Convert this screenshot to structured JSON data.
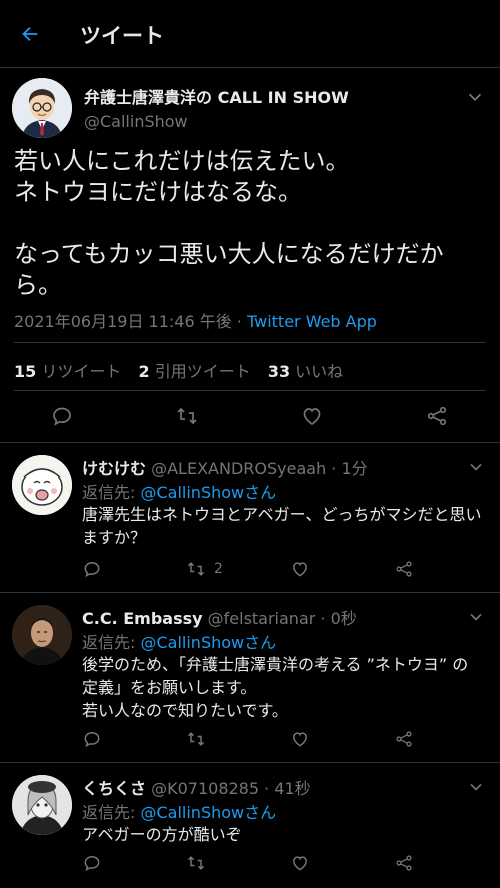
{
  "header": {
    "title": "ツイート"
  },
  "tweet": {
    "name": "弁護士唐澤貴洋の CALL IN SHOW",
    "handle": "@CallinShow",
    "text": "若い人にこれだけは伝えたい。\nネトウヨにだけはなるな。\n\nなってもカッコ悪い大人になるだけだから。",
    "datetime": "2021年06月19日 11:46 午後 · ",
    "app": "Twitter Web App",
    "stats": {
      "retweets_count": "15",
      "retweets_label": "リツイート",
      "quotes_count": "2",
      "quotes_label": "引用ツイート",
      "likes_count": "33",
      "likes_label": "いいね"
    }
  },
  "replies": [
    {
      "name": "けむけむ",
      "handle": "@ALEXANDROSyeaah",
      "time": "· 1分",
      "reply_label": "返信先: ",
      "reply_to": "@CallinShowさん",
      "text": "唐澤先生はネトウヨとアベガー、どっちがマシだと思いますか？",
      "retweet_count": "2"
    },
    {
      "name": "C.C. Embassy",
      "handle": "@felstarianar",
      "time": "· 0秒",
      "reply_label": "返信先: ",
      "reply_to": "@CallinShowさん",
      "text": "後学のため、「弁護士唐澤貴洋の考える ”ネトウヨ” の定義」をお願いします。\n若い人なので知りたいです。",
      "retweet_count": ""
    },
    {
      "name": "くちくさ",
      "handle": "@K07108285",
      "time": "· 41秒",
      "reply_label": "返信先: ",
      "reply_to": "@CallinShowさん",
      "text": "アベガーの方が酷いぞ",
      "retweet_count": ""
    }
  ],
  "colors": {
    "accent": "#1d9bf0",
    "muted": "#71767b",
    "text": "#e7e9ea",
    "border": "#2f3336"
  }
}
